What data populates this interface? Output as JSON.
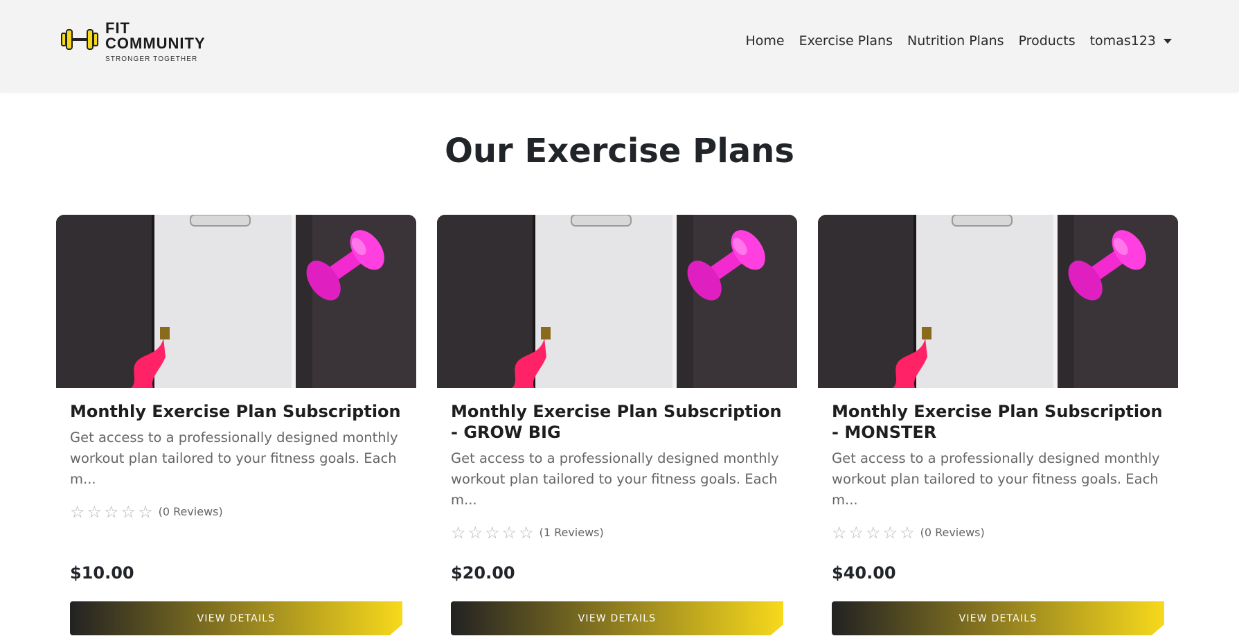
{
  "brand": {
    "title_line1": "FIT",
    "title_line2": "COMMUNITY",
    "tagline": "STRONGER TOGETHER",
    "accent": "#f7d91c"
  },
  "nav": {
    "links": [
      "Home",
      "Exercise Plans",
      "Nutrition Plans",
      "Products"
    ],
    "user": "tomas123"
  },
  "page": {
    "title": "Our Exercise Plans"
  },
  "cards": [
    {
      "title": "Monthly Exercise Plan Subscription",
      "description": "Get access to a professionally designed monthly workout plan tailored to your fitness goals. Each m...",
      "rating": 0,
      "reviews": "(0 Reviews)",
      "price": "$10.00",
      "button": "VIEW DETAILS"
    },
    {
      "title": "Monthly Exercise Plan Subscription - GROW BIG",
      "description": "Get access to a professionally designed monthly workout plan tailored to your fitness goals. Each m...",
      "rating": 0,
      "reviews": "(1 Reviews)",
      "price": "$20.00",
      "button": "VIEW DETAILS"
    },
    {
      "title": "Monthly Exercise Plan Subscription - MONSTER",
      "description": "Get access to a professionally designed monthly workout plan tailored to your fitness goals. Each m...",
      "rating": 0,
      "reviews": "(0 Reviews)",
      "price": "$40.00",
      "button": "VIEW DETAILS"
    }
  ],
  "colors": {
    "navbar_bg": "#f3f3f3",
    "button_gradient_start": "#222222",
    "button_gradient_end": "#f7d91c",
    "dumbbell": "#ff2bd6",
    "measuring_tape": "#ff2266"
  }
}
